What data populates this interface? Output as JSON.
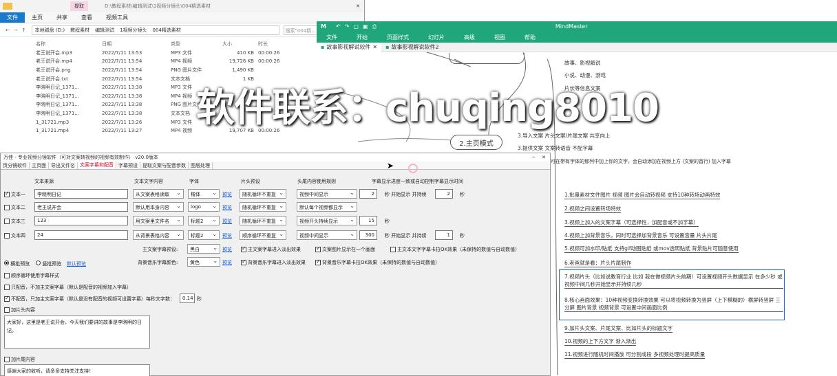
{
  "explorer": {
    "tab_extract": "提取",
    "path_title": "D:\\教程素材\\编辑测试\\1视频分镜头\\004精选素材",
    "video_tools": "视频工具",
    "ribbon": [
      "文件",
      "主页",
      "共享",
      "查看",
      "播放"
    ],
    "breadcrumb": [
      "本地磁盘 (D:)",
      "教程素材",
      "编辑测试",
      "1视频分镜头",
      "004精选素材"
    ],
    "search_placeholder": "搜索\"004精...",
    "columns": [
      "名称",
      "日期",
      "类型",
      "大小",
      "时长"
    ],
    "rows": [
      {
        "name": "老王说开会.mp3",
        "date": "2022/7/11 13:53",
        "type": "MP3 文件",
        "size": "410 KB",
        "dur": "00:00:26"
      },
      {
        "name": "老王说开会.mp4",
        "date": "2022/7/11 13:54",
        "type": "MP4 视频",
        "size": "19,726 KB",
        "dur": "00:00:26"
      },
      {
        "name": "老王说开会.png",
        "date": "2022/7/11 13:54",
        "type": "PNG 图片文件",
        "size": "1,490 KB",
        "dur": ""
      },
      {
        "name": "老王说开会.txt",
        "date": "2022/7/11 13:54",
        "type": "文本文档",
        "size": "1 KB",
        "dur": ""
      },
      {
        "name": "李晓明日记_1371...",
        "date": "2022/7/11 13:38",
        "type": "MP3 文件",
        "size": "",
        "dur": ""
      },
      {
        "name": "李晓明日记_1371...",
        "date": "2022/7/11 13:38",
        "type": "MP4 视频",
        "size": "",
        "dur": ""
      },
      {
        "name": "李晓明日记_1371...",
        "date": "2022/7/11 13:38",
        "type": "PNG 图片文件",
        "size": "",
        "dur": ""
      },
      {
        "name": "李晓明日记_1371...",
        "date": "2022/7/11 13:38",
        "type": "文本文档",
        "size": "",
        "dur": ""
      },
      {
        "name": "1_31721.mp3",
        "date": "2022/7/11 13:26",
        "type": "MP3 文件",
        "size": "",
        "dur": ""
      },
      {
        "name": "1_31721.mp4",
        "date": "2022/7/11 13:27",
        "type": "MP4 视频",
        "size": "19,707 KB",
        "dur": "00:00:26"
      }
    ]
  },
  "mindmaster": {
    "title": "MindMaster",
    "menu": [
      "文件",
      "开始",
      "页面样式",
      "幻灯片",
      "高级",
      "视图",
      "帮助"
    ],
    "tabs": [
      "故事影视解说软件",
      "故事影视解说软件2"
    ],
    "topics": [
      "故事、影视解说",
      "小说、动漫、游戏",
      "片长等信息文案"
    ],
    "bubble": "2.主页模式",
    "rows_above": [
      "3.导入文案 片头文案/片尾文案 共享向上",
      "3.提供文案 文案转语音 不配字幕"
    ],
    "note": "可在带有字体的那列中加上你的文字，会自动添加在视频上方 (文案的首行) 加入字幕",
    "leaves": [
      "1.批量素材文件图片 视频 图片会自动转视频 支持10种转场动画特效",
      "2.视频之间设置转场特效",
      "3.视频上加入的文案字幕（可选择性，加配音或不加字幕）",
      "4.视频上加背景音乐，同时可选择加背景音乐 可设置音量 片头片尾",
      "5.视频可加水印/贴纸 支持gif动图贴纸 或mov透明贴纸 背景贴片可随意使用",
      "6.老爸就是看：片头片尾制作",
      "7.视频片头（比如说教育行业 比如 我在做视频片头前期）可设置视频开头数据显示 在多少秒 或视频中间几秒开始显示并持续几秒",
      "8.核心画面效果：10种视频变换转换效果 可以将视频转换为竖屏（上下模糊的）横屏转竖屏 三分屏 图片背景 视频背景 可设置中间画面比例",
      "9.加片头文案、片尾文案、比如片头的标题文字",
      "10.视频的上下方文字 渐入渐出",
      "11.视频进行随机时间播放 可分割成段 多视频处理时提高质量"
    ]
  },
  "dialog": {
    "title": "万佳 - 专业视频分镜软件（可对文案转视频的视频有效制作） v20.0版本",
    "tabs": [
      "页分镜软件",
      "主页面",
      "导出文件名",
      "文案字幕和配音",
      "字幕预设",
      "提取文案与配音参数",
      "图层处理"
    ],
    "headers": [
      "文本来源",
      "文本文字内容",
      "字体",
      "片头预设",
      "头尾内容使用规则",
      "字幕显示进度一致或自动控制字幕显示时间"
    ],
    "rows": [
      {
        "label": "文本一",
        "checked": true,
        "text": "李晓明日记",
        "src": "从文案表格读取",
        "font": "楷体",
        "mode": "随机循环不重复",
        "pos": "视频中间显示",
        "num1": "2",
        "sec_label": "秒 开始显示 并持续",
        "num2": "2",
        "sec2": "秒"
      },
      {
        "label": "文本二",
        "checked": false,
        "text": "老王说开会",
        "src": "默认用本身内容",
        "font": "logo",
        "mode": "随机循环不重复",
        "pos": "默认每个视频都显示",
        "num1": "",
        "sec_label": "",
        "num2": "",
        "sec2": ""
      },
      {
        "label": "文本三",
        "checked": false,
        "text": "123",
        "src": "用文案里文件名",
        "font": "标题2",
        "mode": "随机循环不重复",
        "pos": "视频开头持续显示",
        "num1": "15",
        "sec_label": "秒",
        "num2": "",
        "sec2": ""
      },
      {
        "label": "文本四",
        "checked": false,
        "text": "24",
        "src": "从背景表格内容",
        "font": "标题2",
        "mode": "顺序循环不重复",
        "pos": "视频中间显示",
        "num1": "300",
        "sec_label": "秒 开始显示 并持续",
        "num2": "1",
        "sec2": "秒"
      }
    ],
    "preview_link": "预览",
    "subtitle_preset_label": "主文案字幕预设:",
    "subtitle_preset": "黑白",
    "bg_color_label": "背景音乐字幕颜色:",
    "bg_color": "黄色",
    "opt1": "主文案字幕进入淡出效果",
    "opt2": "文案图片显示在一个画面",
    "opt3": "主文本文字字幕卡拉OK效果（未保持的数值与自动数值）",
    "opt4": "背景音乐字幕进入淡出效果",
    "opt5": "背景音乐字幕卡拉OK效果（未保持的数值与自动数值）",
    "radio1": "横批预览",
    "radio2": "竖批预览",
    "radio_link": "默认预览",
    "check_a": "顺序循环使用字幕样式",
    "check_b": "只配音，不加主文案字幕（默认是配音的视频加入字幕）",
    "check_c": "不配音，只加主文案字幕（默认是没有配音的视频可设置字幕）每秒文字数：",
    "speed": "0.14",
    "speed_unit": "秒",
    "check_d": "加片头内容",
    "intro_text": "大家好，这里是老王说开会，今天我们要讲的故事是李晓明的日记。",
    "check_e": "加片尾内容",
    "outro_text": "感谢大家的收听，请多多支持关注支持！"
  },
  "watermark": "软件联系：chuqing8010"
}
